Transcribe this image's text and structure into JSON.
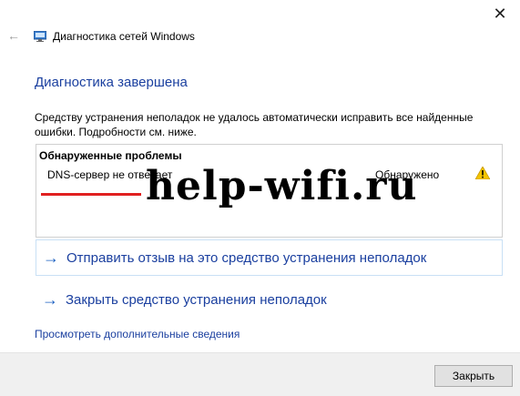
{
  "window": {
    "title": "Диагностика сетей Windows",
    "close_glyph": "✕",
    "back_glyph": "←"
  },
  "main": {
    "heading": "Диагностика завершена",
    "description": "Средству устранения неполадок не удалось автоматически исправить все найденные ошибки. Подробности см. ниже.",
    "problems": {
      "header": "Обнаруженные проблемы",
      "items": [
        {
          "name": "DNS-сервер не отвечает",
          "status": "Обнаружено",
          "icon": "warning-icon"
        }
      ]
    },
    "watermark": "help-wifi.ru",
    "actions": [
      {
        "label": "Отправить отзыв на это средство устранения неполадок",
        "icon": "arrow-right-icon"
      },
      {
        "label": "Закрыть средство устранения неполадок",
        "icon": "arrow-right-icon"
      }
    ],
    "details_link": "Просмотреть дополнительные сведения"
  },
  "footer": {
    "close_label": "Закрыть"
  },
  "colors": {
    "link_blue": "#1a3f9f",
    "arrow_blue": "#1a5fc1",
    "warning_yellow": "#f4c400",
    "underline_red": "#e02020"
  }
}
